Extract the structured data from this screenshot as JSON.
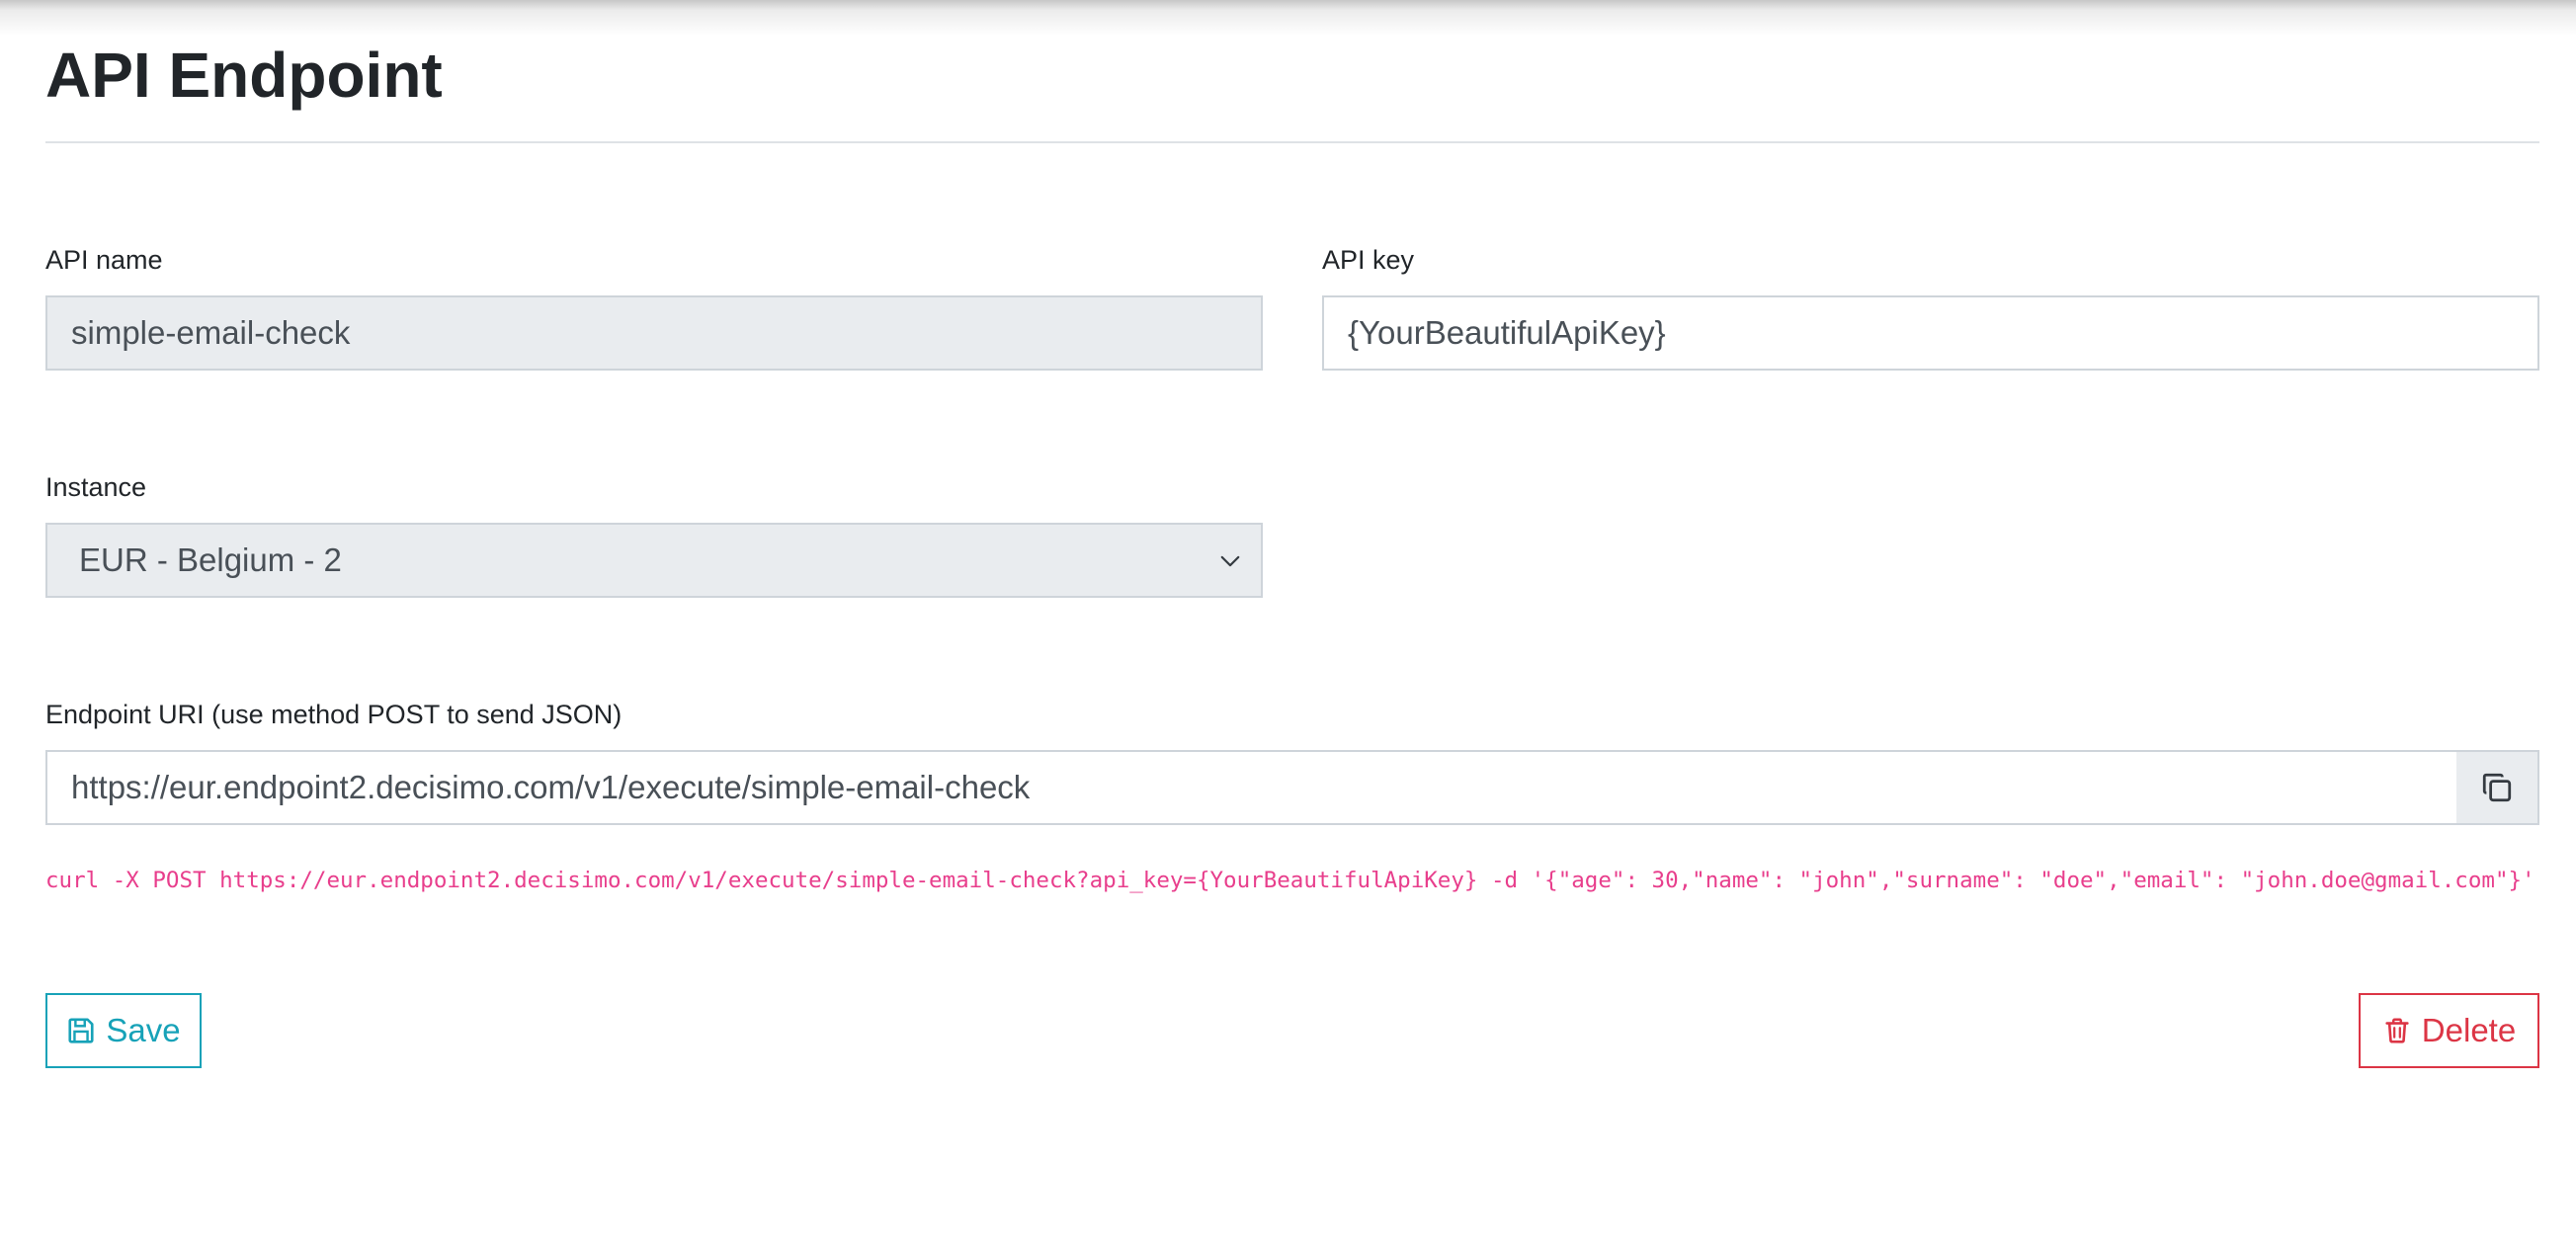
{
  "page": {
    "title": "API Endpoint"
  },
  "form": {
    "api_name": {
      "label": "API name",
      "value": "simple-email-check"
    },
    "api_key": {
      "label": "API key",
      "value": "{YourBeautifulApiKey}"
    },
    "instance": {
      "label": "Instance",
      "selected": "EUR - Belgium - 2"
    },
    "endpoint": {
      "label": "Endpoint URI (use method POST to send JSON)",
      "value": "https://eur.endpoint2.decisimo.com/v1/execute/simple-email-check",
      "copy_icon": "copy-icon"
    },
    "curl_example": "curl -X POST https://eur.endpoint2.decisimo.com/v1/execute/simple-email-check?api_key={YourBeautifulApiKey} -d '{\"age\": 30,\"name\": \"john\",\"surname\": \"doe\",\"email\": \"john.doe@gmail.com\"}'"
  },
  "actions": {
    "save_label": "Save",
    "save_icon": "floppy-disk-icon",
    "delete_label": "Delete",
    "delete_icon": "trash-icon"
  },
  "colors": {
    "save": "#17a2b8",
    "delete": "#dc3545",
    "code": "#e83e8c",
    "readonly_bg": "#e9ecef",
    "border": "#ced4da"
  }
}
